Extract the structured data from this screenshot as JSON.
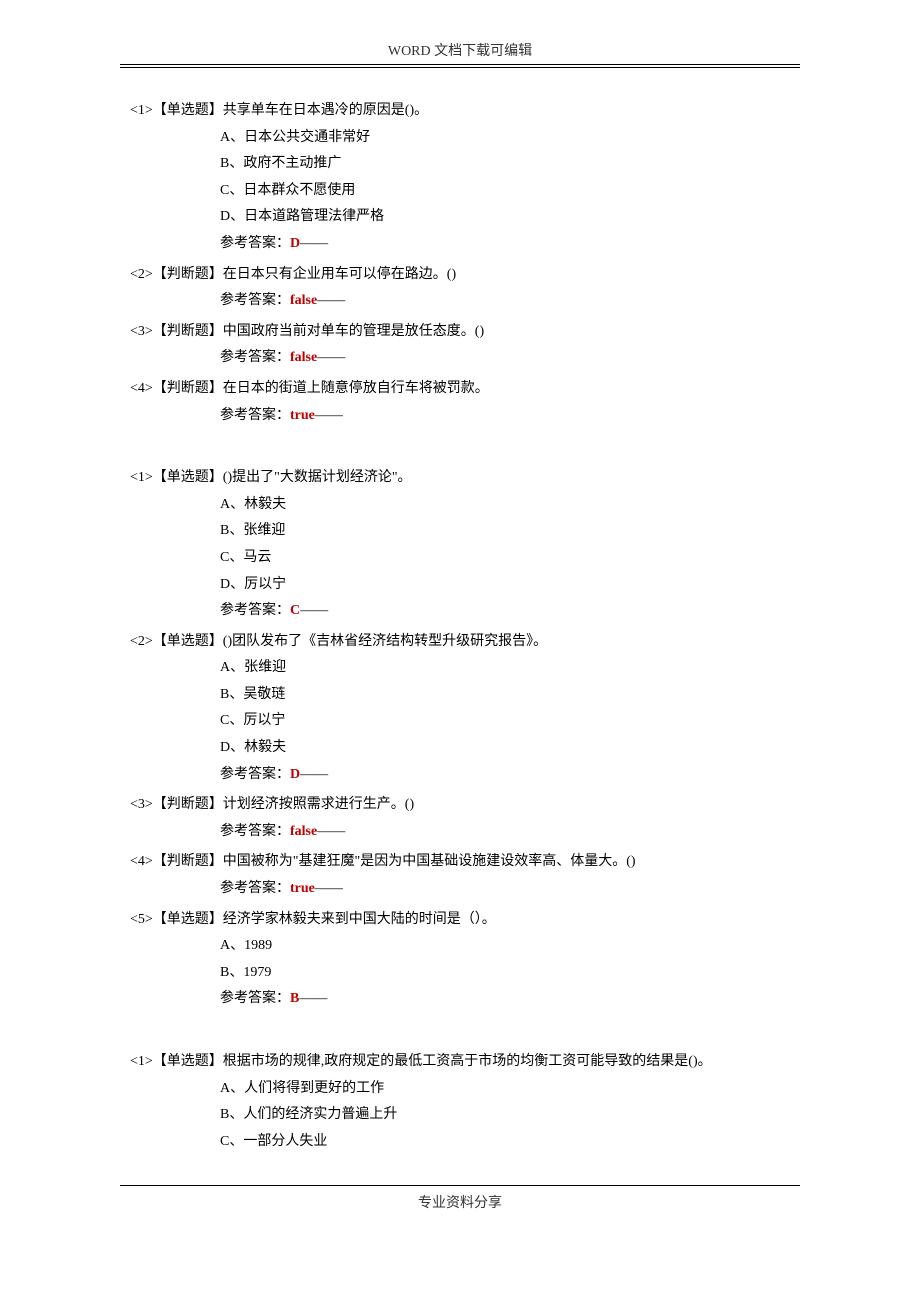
{
  "header": "WORD 文档下载可编辑",
  "footer": "专业资料分享",
  "answer_label": "参考答案：",
  "dash": "——",
  "sections": [
    {
      "questions": [
        {
          "num": "<1>",
          "type": "【单选题】",
          "text": "共享单车在日本遇冷的原因是()。",
          "options": [
            "A、日本公共交通非常好",
            "B、政府不主动推广",
            "C、日本群众不愿使用",
            "D、日本道路管理法律严格"
          ],
          "answer": "D"
        },
        {
          "num": "<2>",
          "type": "【判断题】",
          "text": "在日本只有企业用车可以停在路边。()",
          "options": [],
          "answer": "false"
        },
        {
          "num": "<3>",
          "type": "【判断题】",
          "text": "中国政府当前对单车的管理是放任态度。()",
          "options": [],
          "answer": "false"
        },
        {
          "num": "<4>",
          "type": "【判断题】",
          "text": "在日本的街道上随意停放自行车将被罚款。",
          "options": [],
          "answer": "true"
        }
      ]
    },
    {
      "questions": [
        {
          "num": "<1>",
          "type": "【单选题】",
          "text": "()提出了\"大数据计划经济论\"。",
          "options": [
            "A、林毅夫",
            "B、张维迎",
            "C、马云",
            "D、厉以宁"
          ],
          "answer": "C"
        },
        {
          "num": "<2>",
          "type": "【单选题】",
          "text": "()团队发布了《吉林省经济结构转型升级研究报告》。",
          "options": [
            "A、张维迎",
            "B、吴敬琏",
            "C、厉以宁",
            "D、林毅夫"
          ],
          "answer": "D"
        },
        {
          "num": "<3>",
          "type": "【判断题】",
          "text": "计划经济按照需求进行生产。()",
          "options": [],
          "answer": "false"
        },
        {
          "num": "<4>",
          "type": "【判断题】",
          "text": "中国被称为\"基建狂魔\"是因为中国基础设施建设效率高、体量大。()",
          "options": [],
          "answer": "true"
        },
        {
          "num": "<5>",
          "type": "【单选题】",
          "text": "经济学家林毅夫来到中国大陆的时间是（）。",
          "options": [
            "A、1989",
            "B、1979"
          ],
          "answer": "B"
        }
      ]
    },
    {
      "questions": [
        {
          "num": "<1>",
          "type": "【单选题】",
          "text": "根据市场的规律,政府规定的最低工资高于市场的均衡工资可能导致的结果是()。",
          "options": [
            "A、人们将得到更好的工作",
            "B、人们的经济实力普遍上升",
            "C、一部分人失业"
          ],
          "answer": ""
        }
      ]
    }
  ]
}
